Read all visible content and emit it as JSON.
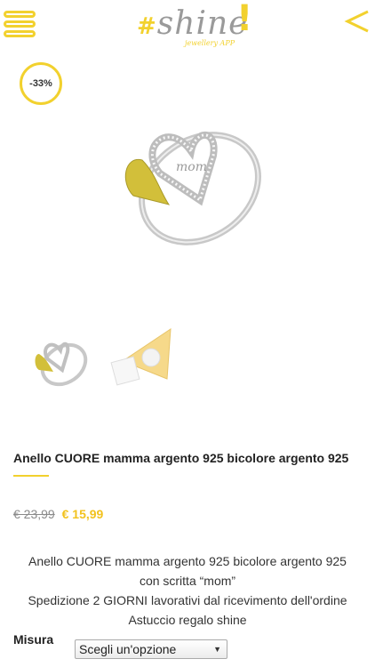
{
  "header": {
    "menu_icon": "hamburger-menu-icon",
    "logo_main": "shine",
    "logo_hash": "#",
    "logo_bang": "!",
    "logo_sub": "jewellery APP",
    "back_icon": "chevron-left-icon"
  },
  "product": {
    "discount_badge": "-33%",
    "title": "Anello CUORE mamma argento 925 bicolore argento 925",
    "old_price": "€ 23,99",
    "new_price": "€ 15,99",
    "description": [
      "Anello CUORE mamma argento 925 bicolore argento 925",
      "con scritta “mom”",
      "Spedizione 2 GIORNI lavorativi dal ricevimento dell'ordine",
      "Astuccio regalo shine"
    ]
  },
  "options": {
    "size_label": "Misura",
    "size_select_value": "Scegli un'opzione"
  },
  "colors": {
    "accent": "#f2d12e",
    "price": "#f2c21e",
    "old_price": "#8a8a8a"
  }
}
